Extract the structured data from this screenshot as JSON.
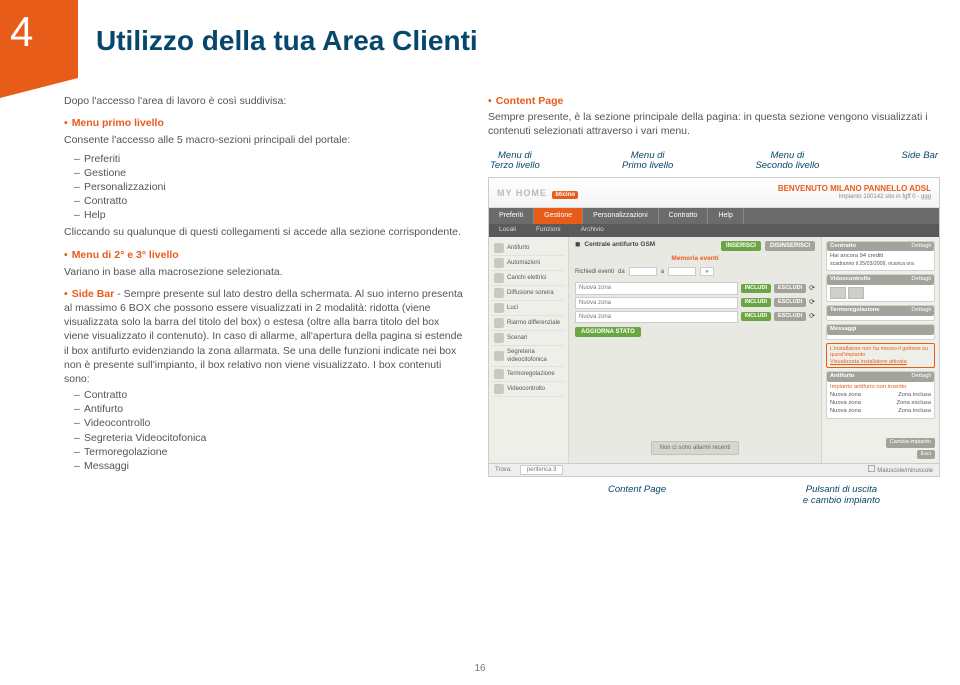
{
  "badge": "4",
  "title": "Utilizzo della tua Area Clienti",
  "intro": "Dopo l'accesso l'area di lavoro è così suddivisa:",
  "s1": {
    "head": "Menu primo livello",
    "desc": "Consente l'accesso alle 5 macro-sezioni principali del portale:",
    "items": [
      "Preferiti",
      "Gestione",
      "Personalizzazioni",
      "Contratto",
      "Help"
    ],
    "tail": "Cliccando su qualunque di questi collegamenti si accede alla sezione corrispondente."
  },
  "s2": {
    "head": "Menu di 2° e 3° livello",
    "desc": "Variano in base alla macrosezione selezionata."
  },
  "s3": {
    "head": "Side Bar",
    "desc": " - Sempre presente sul lato destro della schermata. Al suo interno presenta al massimo 6 BOX che possono essere visualizzati in 2 modalità: ridotta (viene visualizzata solo la barra del titolo del box) o estesa (oltre alla barra titolo del box viene visualizzato il contenuto). In caso di allarme, all'apertura della pagina si estende il box antifurto evidenziando la zona allarmata. Se una delle funzioni indicate nei box non è presente sull'impianto, il box relativo non viene visualizzato. I box contenuti sono:",
    "items": [
      "Contratto",
      "Antifurto",
      "Videocontrollo",
      "Segreteria Videocitofonica",
      "Termoregolazione",
      "Messaggi"
    ]
  },
  "s4": {
    "head": "Content Page",
    "desc": "Sempre presente, è la sezione principale della pagina: in questa sezione vengono visualizzati i contenuti selezionati attraverso i vari menu."
  },
  "callouts_top": [
    "Menu di\nTerzo livello",
    "Menu di\nPrimo livello",
    "Menu di\nSecondo livello",
    "Side Bar"
  ],
  "callouts_bottom": [
    "Content Page",
    "Pulsanti di uscita\ne cambio impianto"
  ],
  "shot": {
    "logo": "MY HOME",
    "logo_tag": "bticino",
    "welcome": "BENVENUTO MILANO PANNELLO ADSL",
    "welcome_sub": "Impianto 100142 sito in fgff 0 - ggg",
    "nav1": [
      "Preferiti",
      "Gestione",
      "Personalizzazioni",
      "Contratto",
      "Help"
    ],
    "nav1_active": 1,
    "nav2": [
      "Locali",
      "Funzioni",
      "Archivio"
    ],
    "left_items": [
      "Antifurto",
      "Automazioni",
      "Carichi elettrici",
      "Diffusione sonora",
      "Luci",
      "Riarmo differenziale",
      "Scenari",
      "Segreteria videocitofonica",
      "Termoregolazione",
      "Videocontrollo"
    ],
    "center": {
      "dev_icon": "◼",
      "dev_label": "Centrale antifurto GSM",
      "btn_ins": "INSERISCI",
      "btn_disins": "DISINSERISCI",
      "mem_title": "Memoria eventi",
      "filter_label1": "Richiedi eventi",
      "filter_da": "da",
      "filter_a": "a",
      "arrow": "»",
      "zones": [
        "Nuova zona",
        "Nuova zona",
        "Nuova zona"
      ],
      "z_inc": "INCLUDI",
      "z_esc": "ESCLUDI",
      "refresh": "⟳",
      "update": "AGGIORNA STATO",
      "alarm_none": "Non ci sono allarmi recenti"
    },
    "side": {
      "box_contratto": "Contratto",
      "dettagli": "Dettagli",
      "credits_line": "Hai ancora 94 crediti",
      "credits_line2": "scadranno il 25/03/2009, ricarica ora",
      "box_video": "Videocontrollo",
      "box_termo": "Termoregolazione",
      "box_mess": "Messaggi",
      "installer_msg": "L'installatore non ha messo il gettone su quest'impianto",
      "installer_link": "Visualizzata installatore attivata",
      "box_antifurto": "Antifurto",
      "ant_sub": "Impianto antifurto non inserito",
      "ant_rows": [
        [
          "Nuova zona",
          "Zona inclusa"
        ],
        [
          "Nuova zona",
          "Zona esclusa"
        ],
        [
          "Nuova zona",
          "Zona inclusa"
        ]
      ],
      "logout1": "Cambia impianto",
      "logout2": "Esci"
    },
    "status_label": "Trova:",
    "status_value": "periferica 3",
    "status_chk": "Maiuscole/minuscole"
  },
  "page_number": "16"
}
